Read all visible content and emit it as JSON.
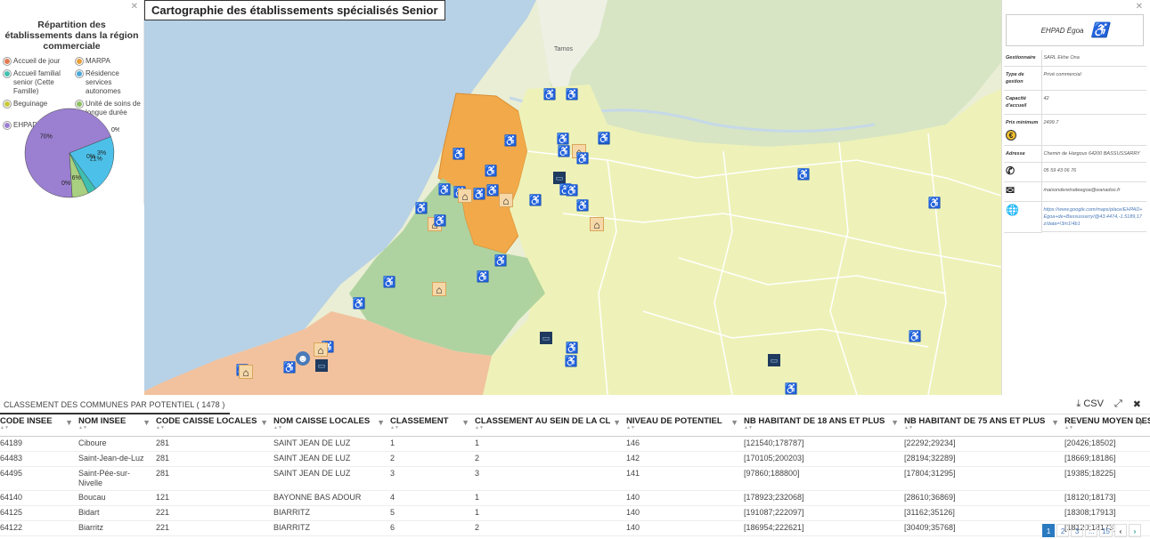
{
  "legend": {
    "title": "Répartition des établissements dans la région commerciale",
    "items": [
      {
        "label": "Accueil de jour",
        "color": "#e07b53"
      },
      {
        "label": "MARPA",
        "color": "#e8a03a"
      },
      {
        "label": "Accueil familial senior (Cette Famille)",
        "color": "#3fbfb0"
      },
      {
        "label": "Résidence services autonomes",
        "color": "#4aa8d8"
      },
      {
        "label": "Beguinage",
        "color": "#c8c838"
      },
      {
        "label": "Unité de soins de longue durée",
        "color": "#8ac060"
      },
      {
        "label": "EHPAD",
        "color": "#9b7fd0"
      }
    ],
    "chart_data": {
      "type": "pie",
      "slices": [
        {
          "name": "EHPAD",
          "value": 70,
          "label": "70%",
          "color": "#9b7fd0"
        },
        {
          "name": "Résidence services autonomes",
          "value": 21,
          "label": "21%",
          "color": "#4cc0e8"
        },
        {
          "name": "Accueil familial senior (Cette Famille)",
          "value": 3,
          "label": "3%",
          "color": "#3fbfb0"
        },
        {
          "name": "Unité de soins de longue durée",
          "value": 6,
          "label": "6%",
          "color": "#a8d080"
        },
        {
          "name": "Accueil de jour",
          "value": 0,
          "label": "0%",
          "color": "#e07b53"
        },
        {
          "name": "MARPA",
          "value": 0,
          "label": "0%",
          "color": "#e8a03a"
        },
        {
          "name": "Beguinage",
          "value": 0,
          "label": "0%",
          "color": "#c8c838"
        }
      ]
    }
  },
  "map": {
    "title": "Cartographie des établissements spécialisés Senior",
    "labels": [
      "Tarnos"
    ],
    "colors": {
      "sea": "#b7d1e6",
      "land": "#e9eed4",
      "orange_zone": "#f2a94a",
      "green_zone": "#a9cf9a",
      "salmon_zone": "#f2c29e",
      "yellow_zone": "#eef2b8"
    }
  },
  "detail": {
    "name": "EHPAD Égoa",
    "rows": [
      {
        "key": "Gestionnaire",
        "value": "SARL Ekhe Ona"
      },
      {
        "key": "Type de gestion",
        "value": "Privé commercial"
      },
      {
        "key": "Capacité d'accueil",
        "value": "42"
      },
      {
        "key": "Prix minimum",
        "value": "2499.7"
      },
      {
        "key": "Adresse",
        "value": "Chemin de Hargous 64200 BASSUSSARRY"
      },
      {
        "key": "phone-icon",
        "value": "05 59 43 06 76"
      },
      {
        "key": "email-icon",
        "value": "maisonderetraiteegoa@wanadoo.fr"
      },
      {
        "key": "globe-icon",
        "value": "https://www.google.com/maps/place/EHPAD+Égoa+de+Bassussarry/@43.4474,-1.5189,17z/data=!3m1!4b1"
      }
    ]
  },
  "bottom": {
    "tab": "CLASSEMENT DES COMMUNES PAR POTENTIEL ( 1478 )",
    "csv_label": "CSV",
    "columns": [
      "CODE INSEE",
      "NOM INSEE",
      "CODE CAISSE LOCALES",
      "NOM CAISSE LOCALES",
      "CLASSEMENT",
      "CLASSEMENT AU SEIN DE LA CL",
      "NIVEAU DE POTENTIEL",
      "NB HABITANT DE 18 ANS ET PLUS",
      "NB HABITANT DE 75 ANS ET PLUS",
      "REVENU MOYEN DES"
    ],
    "rows": [
      [
        "64189",
        "Ciboure",
        "281",
        "SAINT JEAN DE LUZ",
        "1",
        "1",
        "146",
        "[121540;178787]",
        "[22292;29234]",
        "[20426;18502]"
      ],
      [
        "64483",
        "Saint-Jean-de-Luz",
        "281",
        "SAINT JEAN DE LUZ",
        "2",
        "2",
        "142",
        "[170105;200203]",
        "[28194;32289]",
        "[18669;18186]"
      ],
      [
        "64495",
        "Saint-Pée-sur-Nivelle",
        "281",
        "SAINT JEAN DE LUZ",
        "3",
        "3",
        "141",
        "[97860;188800]",
        "[17804;31295]",
        "[19385;18225]"
      ],
      [
        "64140",
        "Boucau",
        "121",
        "BAYONNE BAS ADOUR",
        "4",
        "1",
        "140",
        "[178923;232068]",
        "[28610;36869]",
        "[18120;18173]"
      ],
      [
        "64125",
        "Bidart",
        "221",
        "BIARRITZ",
        "5",
        "1",
        "140",
        "[191087;222097]",
        "[31162;35126]",
        "[18308;17913]"
      ],
      [
        "64122",
        "Biarritz",
        "221",
        "BIARRITZ",
        "6",
        "2",
        "140",
        "[186954;222621]",
        "[30409;35768]",
        "[18120;18173]"
      ]
    ],
    "pager": [
      "1",
      "2",
      "3",
      "...",
      "15"
    ]
  }
}
